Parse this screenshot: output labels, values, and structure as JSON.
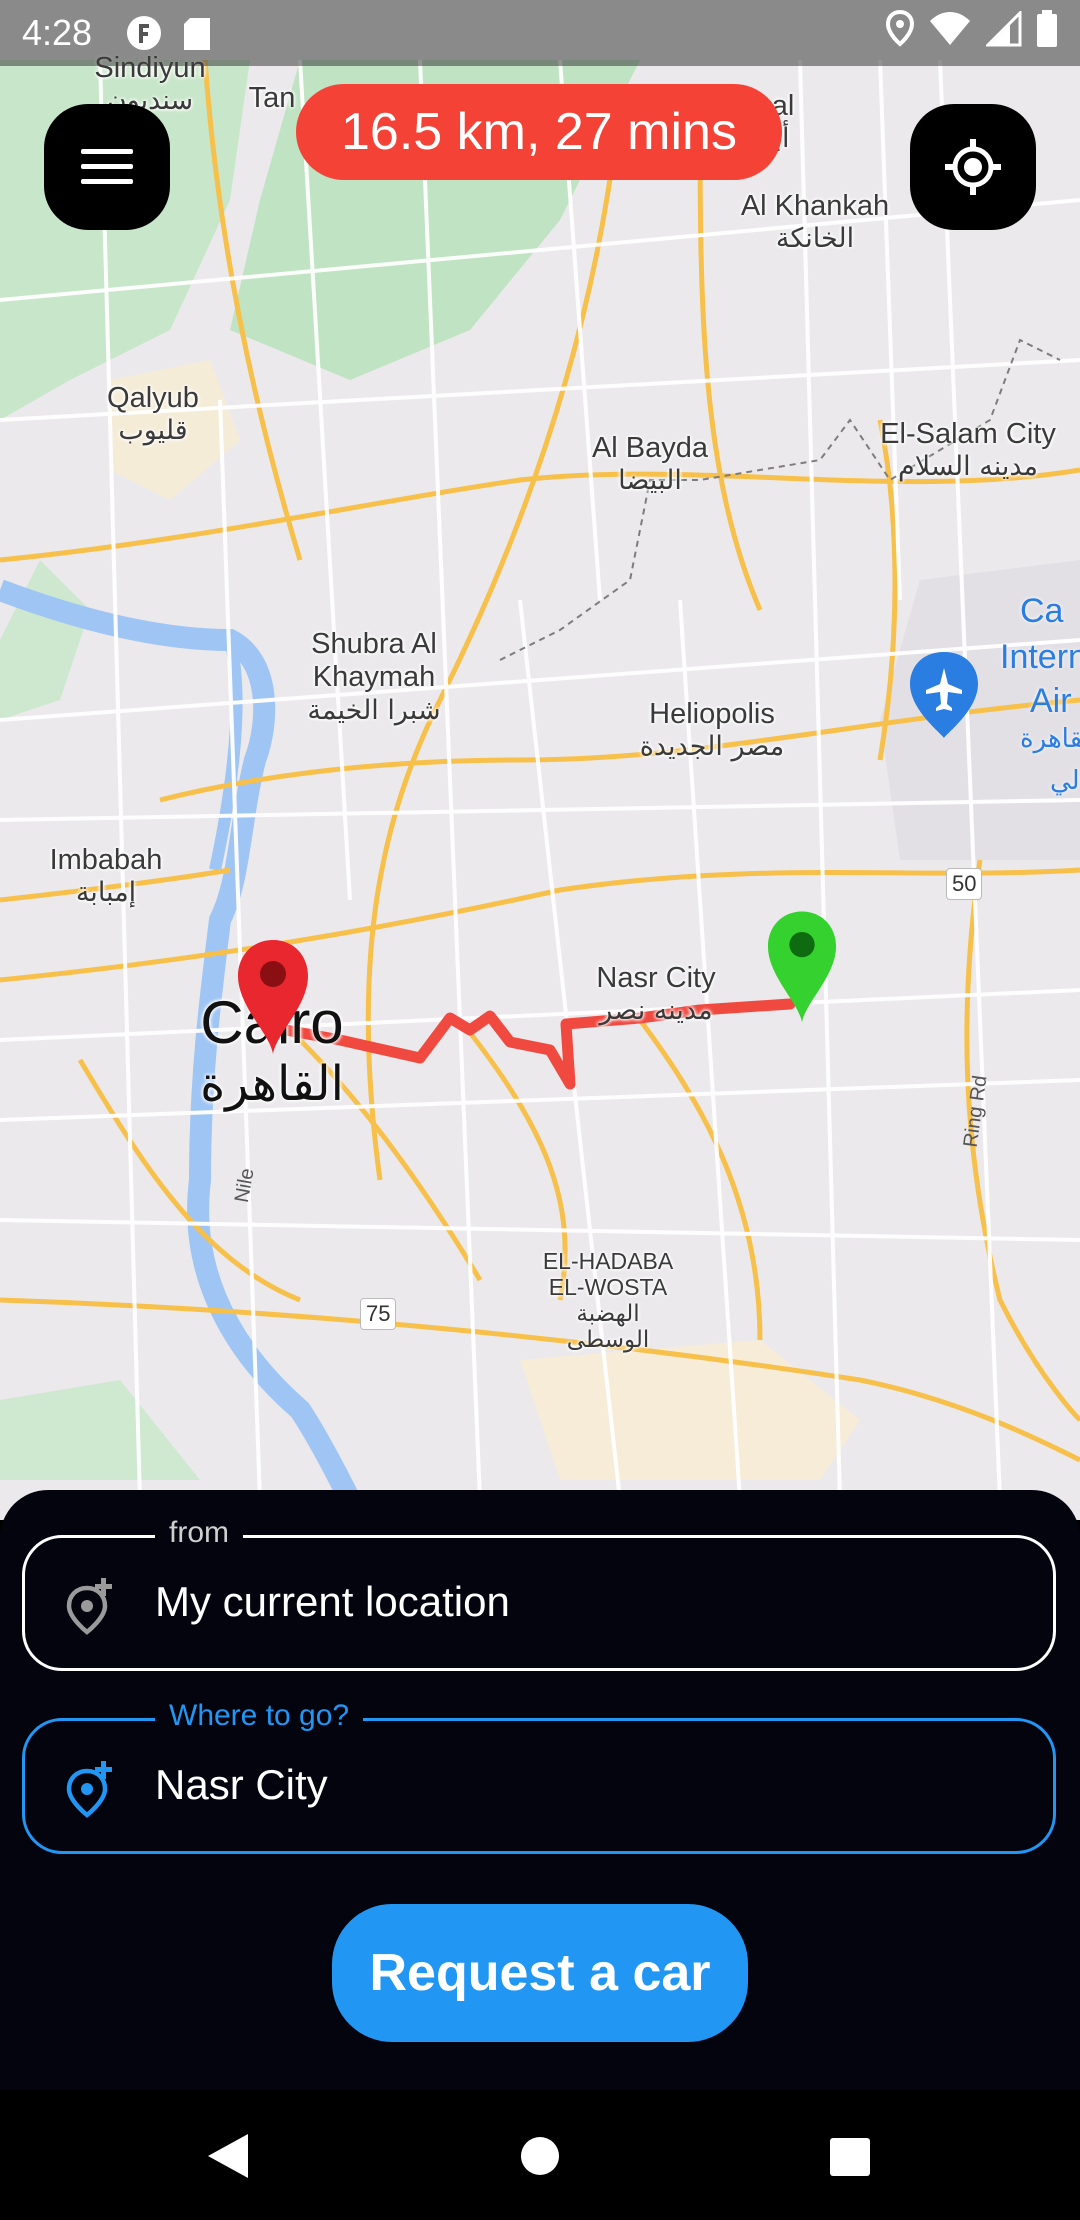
{
  "status_bar": {
    "time": "4:28",
    "left_icons": [
      "fi-icon",
      "sd-card-icon"
    ],
    "right_icons": [
      "location-icon",
      "wifi-icon",
      "signal-icon",
      "battery-icon"
    ]
  },
  "route_summary": "16.5 km, 27 mins",
  "map": {
    "places": [
      {
        "name": "Sindiyun",
        "arabic": "سنديون"
      },
      {
        "name": "Tan",
        "arabic": ""
      },
      {
        "name": "bal",
        "arabic": "أبو"
      },
      {
        "name": "Al Khankah",
        "arabic": "الخانكة"
      },
      {
        "name": "Qalyub",
        "arabic": "قليوب"
      },
      {
        "name": "Al Bayda",
        "arabic": "البيضا"
      },
      {
        "name": "El-Salam City",
        "arabic": "مدينه السلام"
      },
      {
        "name": "Shubra Al Khaymah",
        "arabic": "شبرا الخيمة"
      },
      {
        "name": "Heliopolis",
        "arabic": "مصر الجديدة"
      },
      {
        "name": "Imbabah",
        "arabic": "إمبابة"
      },
      {
        "name": "Nasr City",
        "arabic": "مدينه نصر"
      },
      {
        "name": "Cairo",
        "arabic": "القاهرة"
      },
      {
        "name": "EL-HADABA EL-WOSTA",
        "arabic": "الهضبة الوسطى"
      }
    ],
    "airport_label": [
      "Ca",
      "Intern",
      "Air",
      "القاهرة",
      "لي"
    ],
    "road_shields": [
      "50",
      "75"
    ],
    "road_names": [
      "Ring Rd",
      "Nile"
    ],
    "route_color": "#f04a40",
    "origin_pin_color": "#e8272e",
    "destination_pin_color": "#35d22f"
  },
  "buttons": {
    "menu_icon": "menu-icon",
    "locate_icon": "my-location-icon",
    "request_label": "Request a car"
  },
  "form": {
    "from_label": "from",
    "from_value": "My current location",
    "to_label": "Where to go?",
    "to_value": "Nasr City",
    "accent": "#2196f3"
  },
  "nav_bar": [
    "back-icon",
    "home-icon",
    "recents-icon"
  ]
}
